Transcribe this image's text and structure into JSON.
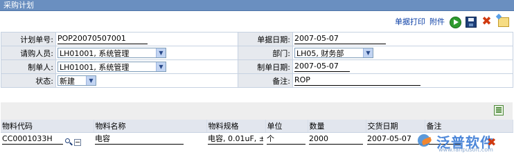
{
  "window": {
    "title": "采购计划"
  },
  "toolbar": {
    "print_label": "单据打印",
    "attach_label": "附件"
  },
  "form": {
    "plan_no": {
      "label": "计划单号:",
      "value": "POP20070507001"
    },
    "doc_date": {
      "label": "单据日期:",
      "value": "2007-05-07"
    },
    "requester": {
      "label": "请购人员:",
      "value": "LH01001, 系统管理"
    },
    "dept": {
      "label": "部门:",
      "value": "LH05, 财务部"
    },
    "creator": {
      "label": "制单人:",
      "value": "LH01001, 系统管理"
    },
    "create_date": {
      "label": "制单日期:",
      "value": "2007-05-07"
    },
    "status": {
      "label": "状态:",
      "value": "新建"
    },
    "remark": {
      "label": "备注:",
      "value": "ROP"
    }
  },
  "grid": {
    "headers": [
      "物料代码",
      "物料名称",
      "物料规格",
      "单位",
      "数量",
      "交货日期",
      "备注"
    ],
    "rows": [
      {
        "code": "CC0001033H",
        "name": "电容",
        "spec": "电容, 0.01uF, ±",
        "unit": "个",
        "qty": "2000",
        "date": "2007-05-07",
        "remark": ""
      }
    ]
  },
  "watermark": {
    "text": "泛普软件",
    "url": "www.fanpusoft.com"
  }
}
